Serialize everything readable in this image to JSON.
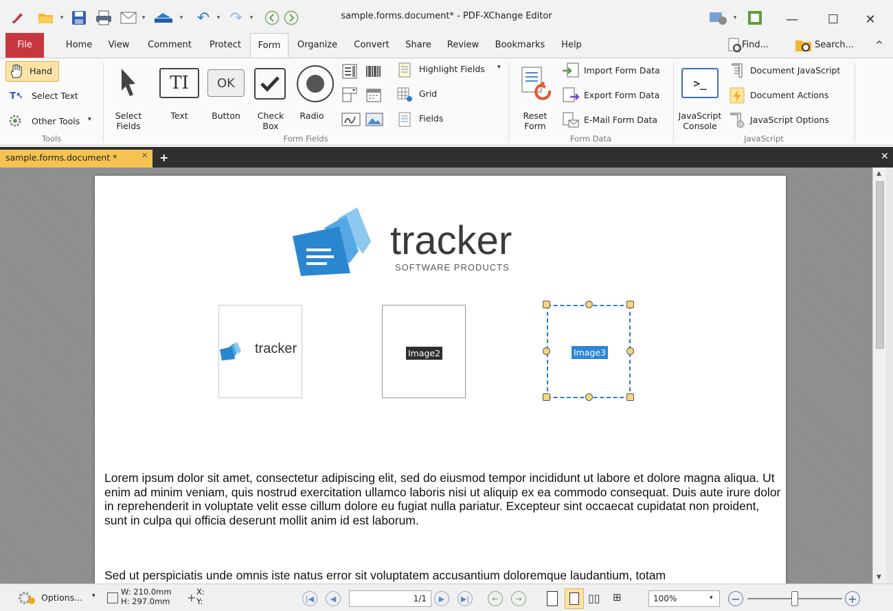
{
  "titlebar": {
    "title": "sample.forms.document* - PDF-XChange Editor"
  },
  "menu": {
    "tabs": [
      "File",
      "Home",
      "View",
      "Comment",
      "Protect",
      "Form",
      "Organize",
      "Convert",
      "Share",
      "Review",
      "Bookmarks",
      "Help"
    ],
    "find": "Find...",
    "search": "Search..."
  },
  "ribbon": {
    "tools": {
      "hand": "Hand",
      "select_text": "Select Text",
      "other_tools": "Other Tools",
      "group": "Tools"
    },
    "form_fields": {
      "select_fields_1": "Select",
      "select_fields_2": "Fields",
      "text": "Text",
      "button": "Button",
      "check_box_1": "Check",
      "check_box_2": "Box",
      "radio": "Radio",
      "highlight_fields": "Highlight Fields",
      "grid": "Grid",
      "fields": "Fields",
      "group": "Form Fields",
      "ok_icon_text": "OK"
    },
    "form_data": {
      "reset_form_1": "Reset",
      "reset_form_2": "Form",
      "import": "Import Form Data",
      "export": "Export Form Data",
      "email": "E-Mail Form Data",
      "group": "Form Data"
    },
    "javascript": {
      "console_1": "JavaScript",
      "console_2": "Console",
      "document_js": "Document JavaScript",
      "document_actions": "Document Actions",
      "js_options": "JavaScript Options",
      "group": "JavaScript"
    }
  },
  "doc_tab": {
    "name": "sample.forms.document *"
  },
  "page": {
    "logo_word": "tracker",
    "logo_sub": "SOFTWARE PRODUCTS",
    "image2": "Image2",
    "image3": "Image3",
    "paragraph1": "Lorem ipsum dolor sit amet, consectetur adipiscing elit, sed do eiusmod tempor incididunt ut labore et dolore magna aliqua. Ut enim ad minim veniam, quis nostrud exercitation ullamco laboris nisi ut aliquip ex ea commodo consequat. Duis aute irure dolor in reprehenderit in voluptate velit esse cillum dolore eu fugiat nulla pariatur. Excepteur sint occaecat cupidatat non proident, sunt in culpa qui officia deserunt mollit anim id est laborum.",
    "paragraph2": "Sed ut perspiciatis unde omnis iste natus error sit voluptatem accusantium doloremque laudantium, totam"
  },
  "status": {
    "options": "Options...",
    "width": "W: 210.0mm",
    "height": "H: 297.0mm",
    "x": "X:",
    "y": "Y:",
    "page": "1/1",
    "zoom": "100%"
  },
  "colors": {
    "accent": "#2b7cd3",
    "file_tab": "#c8363d",
    "doc_tab": "#f6c350"
  }
}
